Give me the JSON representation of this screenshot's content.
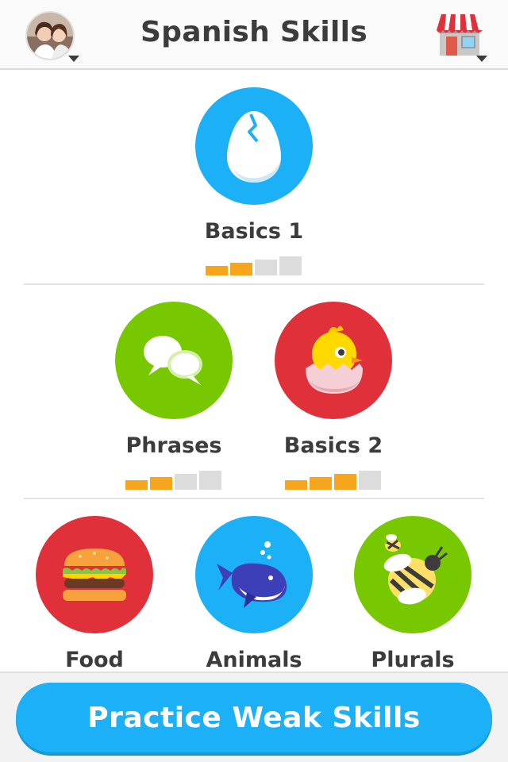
{
  "header": {
    "title": "Spanish Skills",
    "avatar_icon": "profile-avatar",
    "shop_icon": "shop-icon"
  },
  "skills": [
    {
      "name": "Basics 1",
      "icon": "egg-icon",
      "color": "#1cb0f6",
      "strength_bars": 2
    },
    {
      "name": "Phrases",
      "icon": "speech-bubbles-icon",
      "color": "#78c800",
      "strength_bars": 2
    },
    {
      "name": "Basics 2",
      "icon": "chick-icon",
      "color": "#e0313a",
      "strength_bars": 3
    },
    {
      "name": "Food",
      "icon": "burger-icon",
      "color": "#e0313a"
    },
    {
      "name": "Animals",
      "icon": "whale-icon",
      "color": "#1cb0f6"
    },
    {
      "name": "Plurals",
      "icon": "bees-icon",
      "color": "#78c800"
    }
  ],
  "strength_max": 4,
  "colors": {
    "strength_filled": "#f7a51c",
    "strength_empty": "#dcdcdc"
  },
  "practice_button": {
    "label": "Practice Weak Skills"
  }
}
